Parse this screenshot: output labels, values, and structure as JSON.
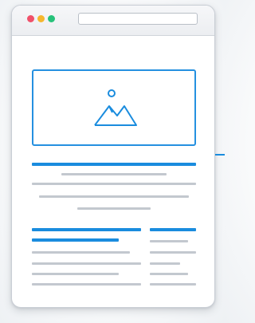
{
  "window": {
    "controls": [
      "close",
      "minimize",
      "maximize"
    ],
    "address_value": ""
  },
  "hero": {
    "icon": "image-placeholder-icon"
  },
  "colors": {
    "accent": "#1a8cde",
    "placeholder_line": "#c3c8cf",
    "close": "#f0516a",
    "minimize": "#f5b72e",
    "maximize": "#27c27a"
  }
}
